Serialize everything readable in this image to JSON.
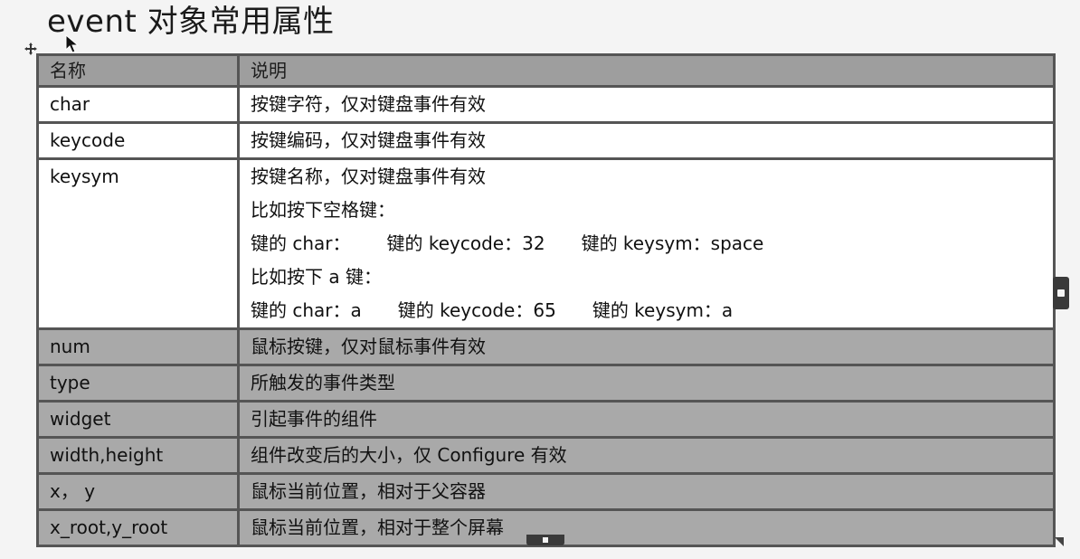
{
  "title": "event 对象常用属性",
  "table": {
    "header": {
      "name": "名称",
      "desc": "说明"
    },
    "rows": [
      {
        "name": "char",
        "lines": [
          "按键字符，仅对键盘事件有效"
        ]
      },
      {
        "name": "keycode",
        "lines": [
          "按键编码，仅对键盘事件有效"
        ]
      },
      {
        "name": "keysym",
        "lines": [
          "按键名称，仅对键盘事件有效",
          "比如按下空格键：",
          [
            "键的 char：",
            "键的 keycode：32",
            "键的 keysym：space"
          ],
          "比如按下 a 键：",
          [
            "键的 char：a",
            "键的 keycode：65",
            "键的 keysym：a"
          ]
        ]
      },
      {
        "name": "num",
        "lines": [
          "鼠标按键，仅对鼠标事件有效"
        ]
      },
      {
        "name": "type",
        "lines": [
          "所触发的事件类型"
        ]
      },
      {
        "name": "widget",
        "lines": [
          "引起事件的组件"
        ]
      },
      {
        "name": "width,height",
        "lines": [
          "组件改变后的大小，仅 Configure 有效"
        ]
      },
      {
        "name": "x， y",
        "lines": [
          "鼠标当前位置，相对于父容器"
        ]
      },
      {
        "name": "x_root,y_root",
        "lines": [
          "鼠标当前位置，相对于整个屏幕"
        ]
      }
    ]
  },
  "row_shading": [
    "light",
    "light",
    "light",
    "dark",
    "dark",
    "dark",
    "dark",
    "dark",
    "dark"
  ],
  "colors": {
    "header_bg": "#9e9e9e",
    "dark_row_bg": "#a9a9a9",
    "light_row_bg": "#ffffff",
    "border": "#555555"
  }
}
